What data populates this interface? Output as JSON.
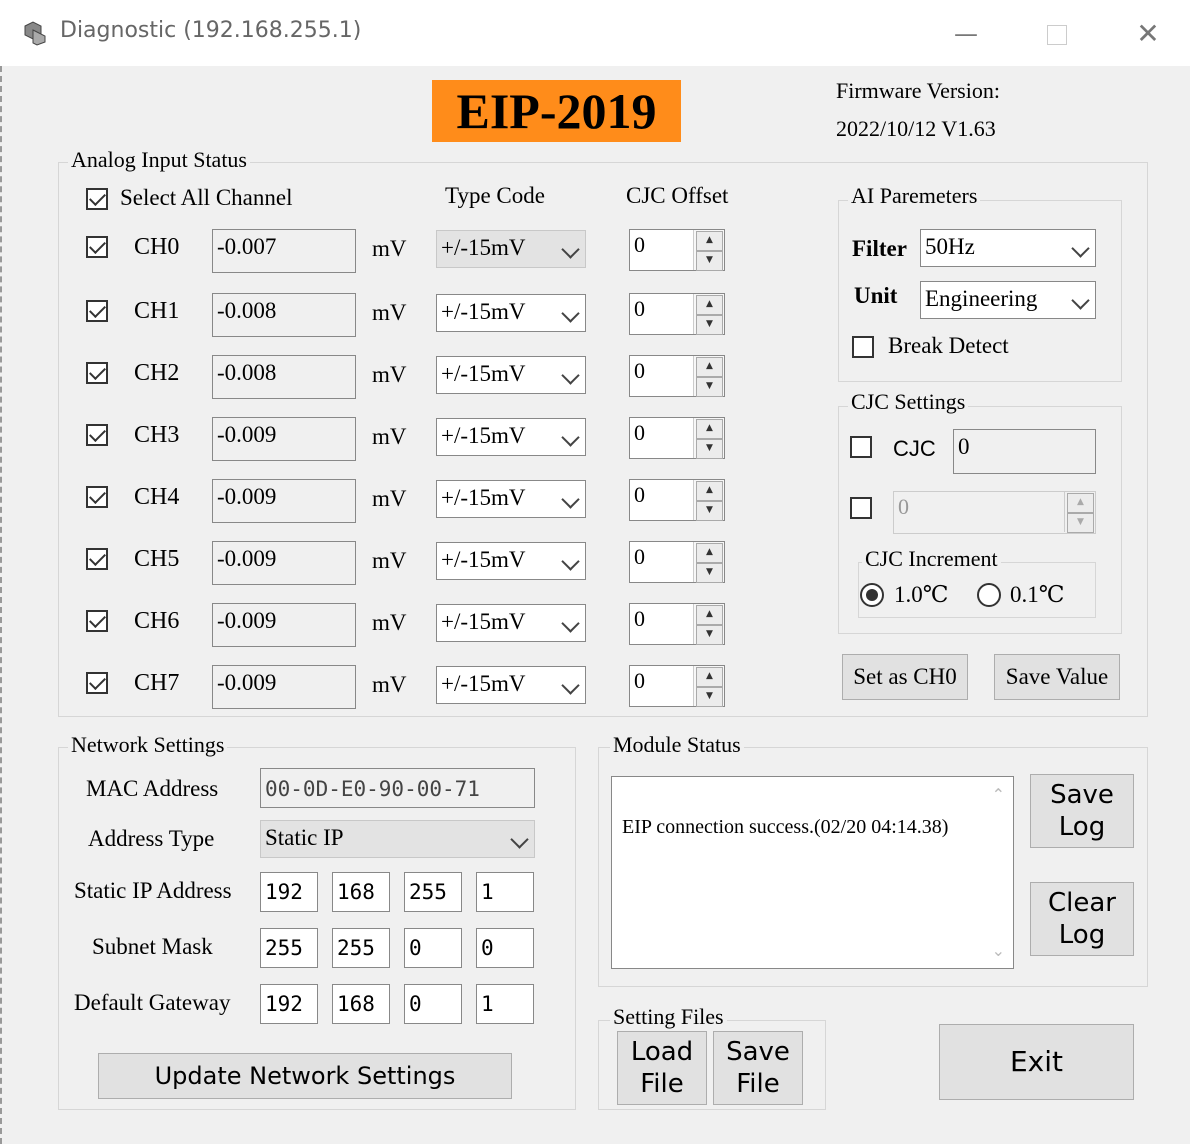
{
  "window": {
    "title": "Diagnostic (192.168.255.1)"
  },
  "header": {
    "model": "EIP-2019",
    "firmware_label": "Firmware Version:",
    "firmware_value": "2022/10/12 V1.63"
  },
  "analog": {
    "title": "Analog Input Status",
    "select_all_label": "Select All Channel",
    "type_code_header": "Type Code",
    "cjc_offset_header": "CJC Offset",
    "unit_label": "mV",
    "channels": [
      {
        "name": "CH0",
        "value": "-0.007",
        "type": "+/-15mV",
        "offset": "0"
      },
      {
        "name": "CH1",
        "value": "-0.008",
        "type": "+/-15mV",
        "offset": "0"
      },
      {
        "name": "CH2",
        "value": "-0.008",
        "type": "+/-15mV",
        "offset": "0"
      },
      {
        "name": "CH3",
        "value": "-0.009",
        "type": "+/-15mV",
        "offset": "0"
      },
      {
        "name": "CH4",
        "value": "-0.009",
        "type": "+/-15mV",
        "offset": "0"
      },
      {
        "name": "CH5",
        "value": "-0.009",
        "type": "+/-15mV",
        "offset": "0"
      },
      {
        "name": "CH6",
        "value": "-0.009",
        "type": "+/-15mV",
        "offset": "0"
      },
      {
        "name": "CH7",
        "value": "-0.009",
        "type": "+/-15mV",
        "offset": "0"
      }
    ]
  },
  "ai_params": {
    "title": "AI Paremeters",
    "filter_label": "Filter",
    "filter_value": "50Hz",
    "unit_label": "Unit",
    "unit_value": "Engineering",
    "break_detect_label": "Break Detect"
  },
  "cjc": {
    "title": "CJC Settings",
    "cjc_label": "CJC",
    "cjc_value": "0",
    "spin_value": "0",
    "increment_title": "CJC Increment",
    "option_1": "1.0℃",
    "option_2": "0.1℃",
    "set_ch0_button": "Set as CH0",
    "save_value_button": "Save Value"
  },
  "network": {
    "title": "Network Settings",
    "mac_label": "MAC Address",
    "mac_value": "00-0D-E0-90-00-71",
    "address_type_label": "Address Type",
    "address_type_value": "Static IP",
    "static_ip_label": "Static IP Address",
    "static_ip": [
      "192",
      "168",
      "255",
      "1"
    ],
    "subnet_label": "Subnet Mask",
    "subnet": [
      "255",
      "255",
      "0",
      "0"
    ],
    "gateway_label": "Default Gateway",
    "gateway": [
      "192",
      "168",
      "0",
      "1"
    ],
    "update_button": "Update Network Settings"
  },
  "module_status": {
    "title": "Module Status",
    "message": "EIP connection success.(02/20 04:14.38)",
    "save_log_button_line1": "Save",
    "save_log_button_line2": "Log",
    "clear_log_button_line1": "Clear",
    "clear_log_button_line2": "Log"
  },
  "setting_files": {
    "title": "Setting Files",
    "load_line1": "Load",
    "load_line2": "File",
    "save_line1": "Save",
    "save_line2": "File"
  },
  "exit_button": "Exit"
}
